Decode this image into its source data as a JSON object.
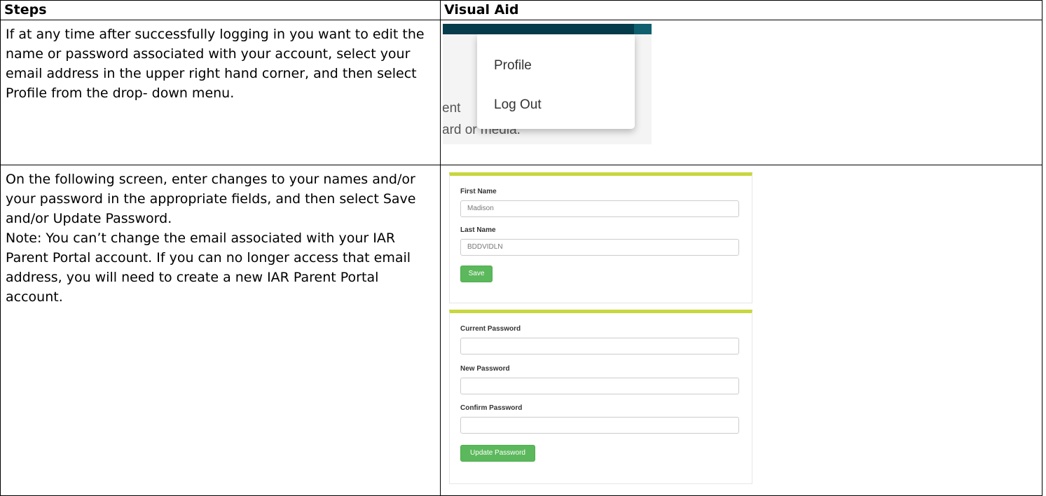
{
  "table": {
    "header": {
      "steps": "Steps",
      "visual_aid": "Visual Aid"
    },
    "rows": [
      {
        "step_text": "If at any time after successfully logging in you want to edit the name or password associated with your account, select your email address in the upper right hand corner, and then select Profile from the drop- down menu."
      },
      {
        "step_text": "On the following screen, enter changes to your names and/or your password in the appropriate fields, and then select Save and/or Update Password.",
        "note_text": "Note: You can’t change the email associated with your IAR Parent Portal account. If you can no longer access that email address, you will need to create a new IAR Parent Portal account."
      }
    ]
  },
  "dropdown_shot": {
    "items": [
      "Profile",
      "Log Out"
    ],
    "background_fragments": [
      "ent",
      "ard or media."
    ]
  },
  "profile_shot": {
    "first_name_label": "First Name",
    "first_name_value": "Madison",
    "last_name_label": "Last Name",
    "last_name_value": "BDDVIDLN",
    "save_label": "Save",
    "current_password_label": "Current Password",
    "new_password_label": "New Password",
    "confirm_password_label": "Confirm Password",
    "update_password_label": "Update Password"
  },
  "colors": {
    "dropdown_header_bar": "#053d4c",
    "panel_accent": "#c7d73e",
    "button_green": "#5cb85c"
  }
}
